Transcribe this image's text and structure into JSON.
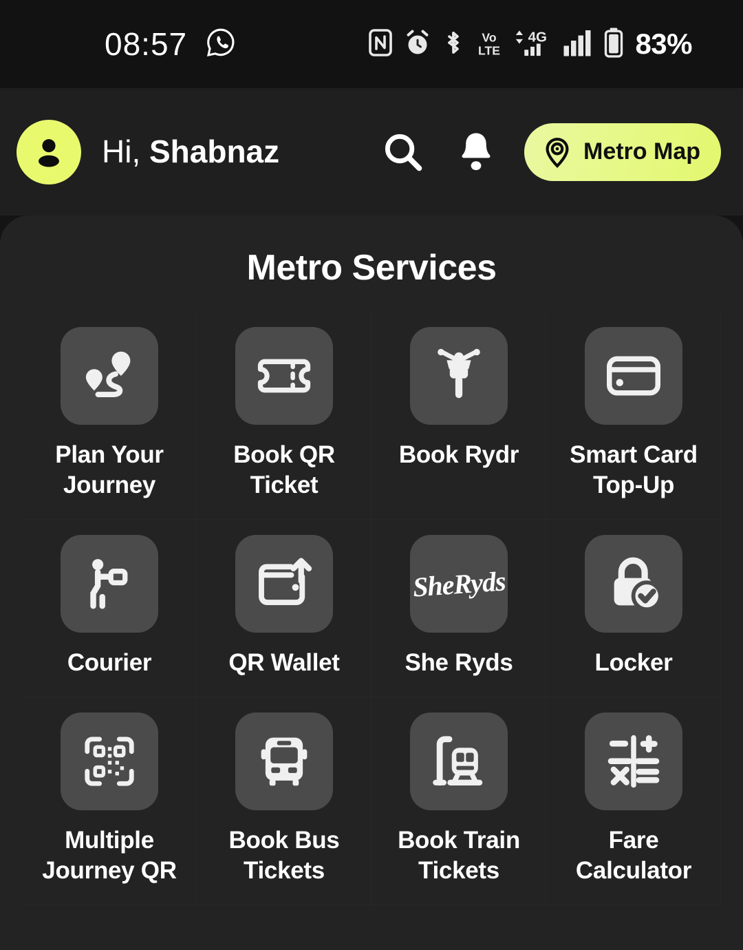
{
  "statusbar": {
    "time": "08:57",
    "app_icon": "whatsapp-icon",
    "icons": [
      "nfc-icon",
      "alarm-icon",
      "bluetooth-icon",
      "volte-icon",
      "network-4g-icon",
      "signal-bars-icon",
      "battery-icon"
    ],
    "battery_percent": "83%"
  },
  "header": {
    "avatar_icon": "person-icon",
    "greeting_prefix": "Hi, ",
    "user_name": "Shabnaz",
    "search_icon": "search-icon",
    "notification_icon": "bell-icon",
    "metro_map_label": "Metro Map",
    "metro_map_icon": "location-pin-icon",
    "accent_color": "#e9f96e",
    "background_color": "#1f1f1f"
  },
  "main": {
    "section_title": "Metro Services",
    "card_color": "#232323",
    "tile_color": "#4b4b4b",
    "services": [
      {
        "label": "Plan Your Journey",
        "icon": "route-pins-icon"
      },
      {
        "label": "Book QR Ticket",
        "icon": "ticket-icon"
      },
      {
        "label": "Book Rydr",
        "icon": "scooter-icon"
      },
      {
        "label": "Smart Card Top-Up",
        "icon": "credit-card-icon"
      },
      {
        "label": "Courier",
        "icon": "courier-person-icon"
      },
      {
        "label": "QR Wallet",
        "icon": "wallet-upload-icon"
      },
      {
        "label": "She Ryds",
        "icon": "sheryds-logo-icon",
        "logo_text": "SheRyds"
      },
      {
        "label": "Locker",
        "icon": "lock-check-icon"
      },
      {
        "label": "Multiple Journey QR",
        "icon": "qr-scan-icon"
      },
      {
        "label": "Book Bus Tickets",
        "icon": "bus-icon"
      },
      {
        "label": "Book Train Tickets",
        "icon": "train-station-icon"
      },
      {
        "label": "Fare Calculator",
        "icon": "calculator-icon"
      }
    ]
  }
}
